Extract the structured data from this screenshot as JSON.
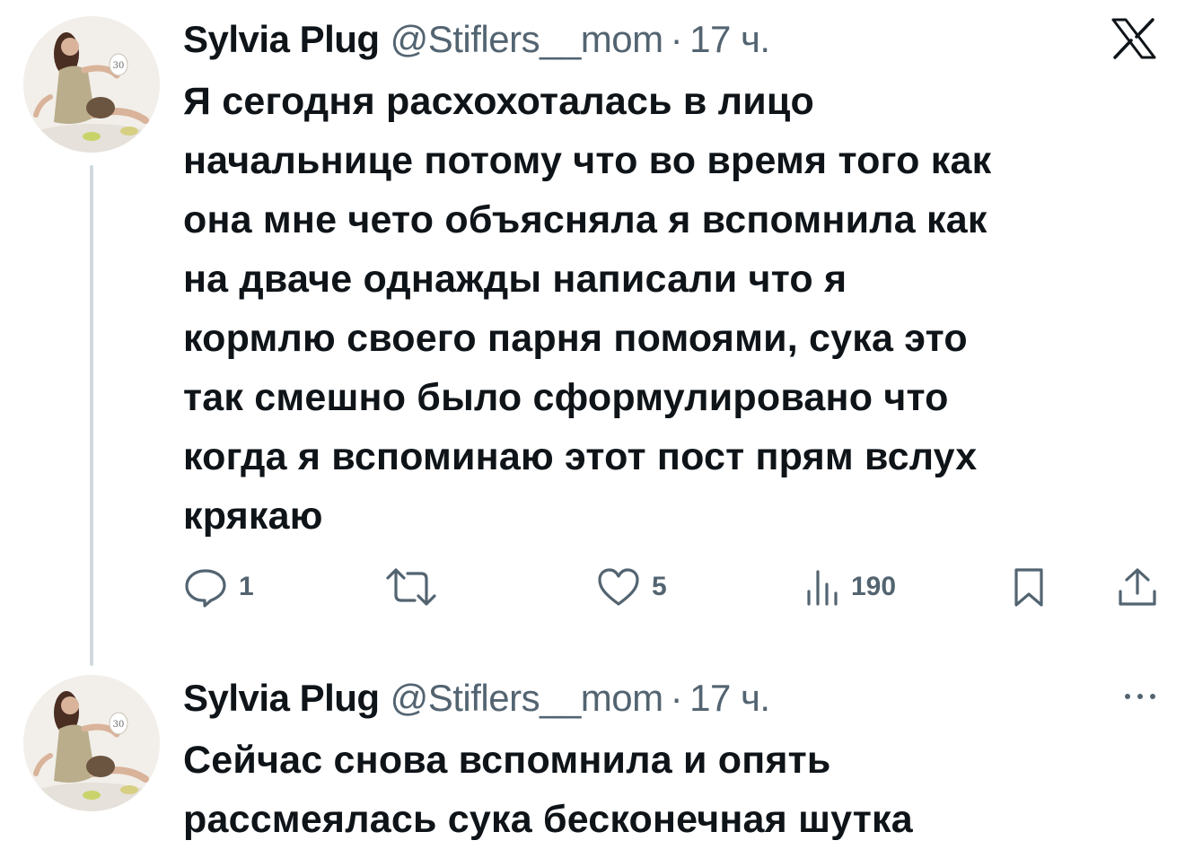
{
  "app": {
    "brand_logo": "x-logo-icon"
  },
  "colors": {
    "text_primary": "#0f1419",
    "text_secondary": "#536471",
    "thread_line": "#cfd9de",
    "icon": "#536471"
  },
  "tweets": [
    {
      "author": {
        "name": "Sylvia Plug",
        "handle": "@Stiflers__mom",
        "avatar": "profile-photo"
      },
      "separator": "·",
      "time": "17 ч.",
      "text": "Я сегодня расхохоталась в лицо\nначальнице потому что во время того как\nона мне чето объясняла я вспомнила как\nна дваче однажды написали что я\nкормлю своего парня помоями, сука это\nтак смешно было сформулировано что\nкогда я вспоминаю этот пост прям вслух\nкрякаю",
      "actions": {
        "replies": "1",
        "reposts": "",
        "likes": "5",
        "views": "190",
        "bookmark_icon": "bookmark-icon",
        "share_icon": "share-icon"
      }
    },
    {
      "author": {
        "name": "Sylvia Plug",
        "handle": "@Stiflers__mom",
        "avatar": "profile-photo"
      },
      "separator": "·",
      "time": "17 ч.",
      "text": "Сейчас снова вспомнила и опять\nрассмеялась сука бесконечная шутка",
      "menu_icon": "more-options-icon"
    }
  ]
}
